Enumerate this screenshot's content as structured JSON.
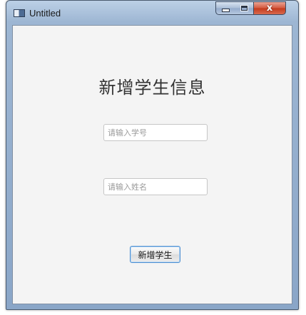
{
  "window": {
    "title": "Untitled",
    "icon": "app-window-icon",
    "controls": {
      "minimize_icon": "minimize-icon",
      "maximize_icon": "maximize-icon",
      "close_icon": "close-icon",
      "close_label": "x",
      "close_color": "#c7402a"
    }
  },
  "form": {
    "heading": "新增学生信息",
    "student_id": {
      "value": "",
      "placeholder": "请输入学号"
    },
    "student_name": {
      "value": "",
      "placeholder": "请输入姓名"
    },
    "submit_label": "新增学生",
    "focus_color": "#4e8fd0"
  }
}
